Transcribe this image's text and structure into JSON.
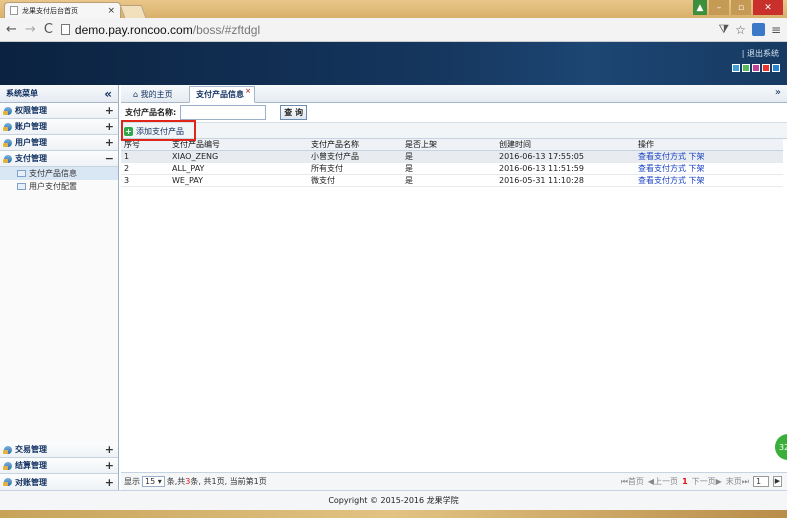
{
  "browser": {
    "tab_title": "龙果支付后台首页",
    "tab_close": "×",
    "url_host": "demo.pay.roncoo.com",
    "url_path": "/boss/#zftdgl",
    "nav_back": "←",
    "nav_forward": "→",
    "nav_reload": "C",
    "right_icons": [
      "filter-icon",
      "star-icon",
      "extension-icon",
      "menu-icon"
    ],
    "window_buttons": [
      "user",
      "minimize",
      "maximize",
      "close"
    ]
  },
  "header": {
    "logout": "| 退出系统",
    "theme_colors": [
      "#3fa0d8",
      "#57b957",
      "#c2439a",
      "#e33",
      "#2b84d4"
    ]
  },
  "sidebar": {
    "title": "系统菜单",
    "collapse": "«",
    "groups_top": [
      {
        "label": "权限管理",
        "toggle": "+"
      },
      {
        "label": "账户管理",
        "toggle": "+"
      },
      {
        "label": "用户管理",
        "toggle": "+"
      },
      {
        "label": "支付管理",
        "toggle": "−"
      }
    ],
    "sub_items": [
      {
        "label": "支付产品信息"
      },
      {
        "label": "用户支付配置"
      }
    ],
    "groups_bottom": [
      {
        "label": "交易管理",
        "toggle": "+"
      },
      {
        "label": "结算管理",
        "toggle": "+"
      },
      {
        "label": "对账管理",
        "toggle": "+"
      }
    ]
  },
  "tabs": {
    "home": "⌂ 我的主页",
    "active": "支付产品信息",
    "active_close": "×",
    "more": "»"
  },
  "search": {
    "label": "支付产品名称:",
    "value": "",
    "button": "查 询"
  },
  "toolbar": {
    "add_label": "添加支付产品",
    "highlight_color": "#e0261a"
  },
  "table": {
    "columns": [
      "序号",
      "支付产品编号",
      "支付产品名称",
      "是否上架",
      "创建时间",
      "操作"
    ],
    "rows": [
      {
        "no": "1",
        "code": "XIAO_ZENG",
        "name": "小曾支付产品",
        "online": "是",
        "created": "2016-06-13 17:55:05",
        "op1": "查看支付方式",
        "op2": "下架"
      },
      {
        "no": "2",
        "code": "ALL_PAY",
        "name": "所有支付",
        "online": "是",
        "created": "2016-06-13 11:51:59",
        "op1": "查看支付方式",
        "op2": "下架"
      },
      {
        "no": "3",
        "code": "WE_PAY",
        "name": "微支付",
        "online": "是",
        "created": "2016-05-31 11:10:28",
        "op1": "查看支付方式",
        "op2": "下架"
      }
    ]
  },
  "pager": {
    "show": "显示",
    "page_size": "15 ▾",
    "summary_pre": "条,共",
    "total": "3",
    "summary_post": "条, 共1页, 当前第1页",
    "first": "⏮首页",
    "prev": "◀上一页",
    "current": "1",
    "next": "下一页▶",
    "last": "末页⏭",
    "page_input": "1",
    "go": "▶"
  },
  "floating_badge": "32",
  "footer": "Copyright © 2015-2016 龙果学院"
}
